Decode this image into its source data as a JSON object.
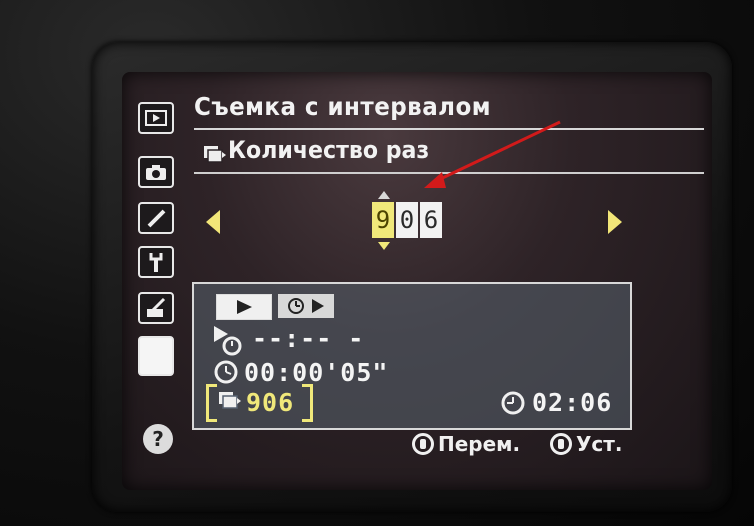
{
  "menu": {
    "title": "Съемка с интервалом",
    "setting_title": "Количество раз",
    "tabs": [
      {
        "name": "playback-menu",
        "icon": "playback-icon"
      },
      {
        "name": "shooting-menu",
        "icon": "camera-icon"
      },
      {
        "name": "custom-settings",
        "icon": "pencil-icon"
      },
      {
        "name": "setup-menu",
        "icon": "wrench-icon"
      },
      {
        "name": "retouch-menu",
        "icon": "retouch-icon"
      },
      {
        "name": "my-menu",
        "icon": "blank-active-tab"
      }
    ],
    "help": "?"
  },
  "counter": {
    "digits": [
      "9",
      "0",
      "6"
    ],
    "selected_index": 0
  },
  "info": {
    "start_time": "--:-- -",
    "interval": "00:00'05\"",
    "shots": "906",
    "duration": "02:06"
  },
  "hints": {
    "move": "Перем.",
    "set": "Уст."
  },
  "colors": {
    "accent_yellow": "#f0e87a",
    "annotation_red": "#d21a1a"
  }
}
